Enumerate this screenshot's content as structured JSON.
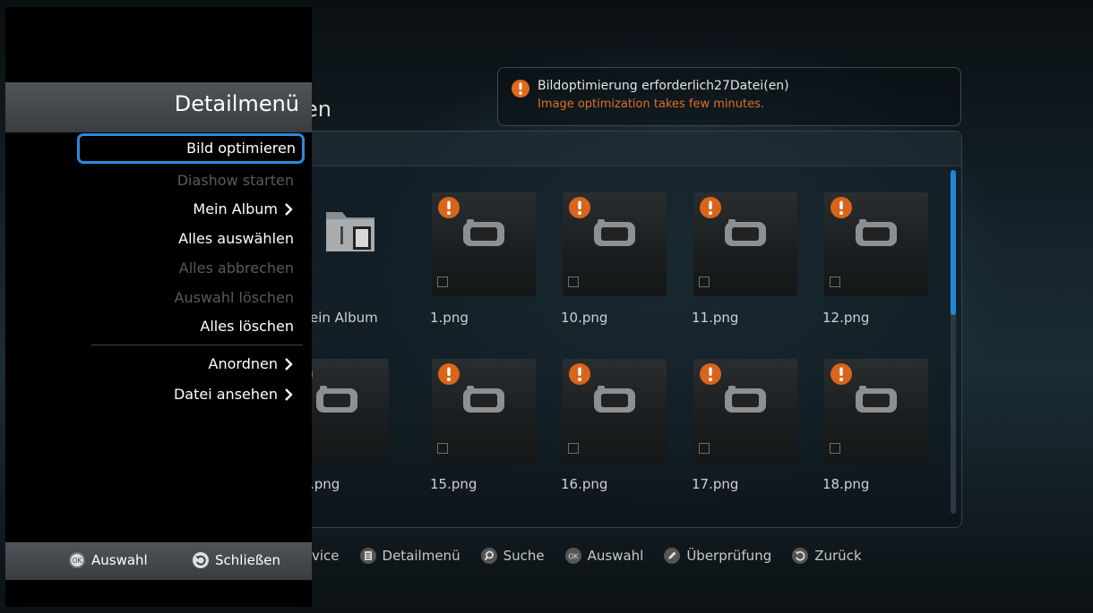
{
  "stage": {
    "title_fragment": "en",
    "notice": {
      "line1": "Bildoptimierung erforderlich27Datei(en)",
      "line2": "Image optimization takes few minutes."
    },
    "tiles": [
      {
        "label": "ein Album",
        "type": "folder"
      },
      {
        "label": "1.png",
        "type": "image"
      },
      {
        "label": "10.png",
        "type": "image"
      },
      {
        "label": "11.png",
        "type": "image"
      },
      {
        "label": "12.png",
        "type": "image"
      },
      {
        "label": ".png",
        "type": "image"
      },
      {
        "label": "15.png",
        "type": "image"
      },
      {
        "label": "16.png",
        "type": "image"
      },
      {
        "label": "17.png",
        "type": "image"
      },
      {
        "label": "18.png",
        "type": "image"
      }
    ],
    "bottom_bar": [
      {
        "icon": "none",
        "label": "vice"
      },
      {
        "icon": "menu-icon",
        "label": "Detailmenü"
      },
      {
        "icon": "search-icon",
        "label": "Suche"
      },
      {
        "icon": "ok-icon",
        "label": "Auswahl"
      },
      {
        "icon": "pen-icon",
        "label": "Überprüfung"
      },
      {
        "icon": "back-icon",
        "label": "Zurück"
      }
    ]
  },
  "menu": {
    "title": "Detailmenü",
    "selected": "Bild optimieren",
    "items": [
      {
        "label": "Diashow starten",
        "enabled": false,
        "submenu": false
      },
      {
        "label": "Mein Album",
        "enabled": true,
        "submenu": true
      },
      {
        "label": "Alles auswählen",
        "enabled": true,
        "submenu": false
      },
      {
        "label": "Alles abbrechen",
        "enabled": false,
        "submenu": false
      },
      {
        "label": "Auswahl löschen",
        "enabled": false,
        "submenu": false
      },
      {
        "label": "Alles löschen",
        "enabled": true,
        "submenu": false
      },
      {
        "label": "Anordnen",
        "enabled": true,
        "submenu": true
      },
      {
        "label": "Datei ansehen",
        "enabled": true,
        "submenu": true
      }
    ],
    "footer": [
      {
        "icon": "ok-icon",
        "label": "Auswahl"
      },
      {
        "icon": "back-icon",
        "label": "Schließen"
      }
    ]
  },
  "colors": {
    "accent": "#2a8ae0",
    "warning": "#e07020",
    "disabled": "#5a5a5a"
  }
}
